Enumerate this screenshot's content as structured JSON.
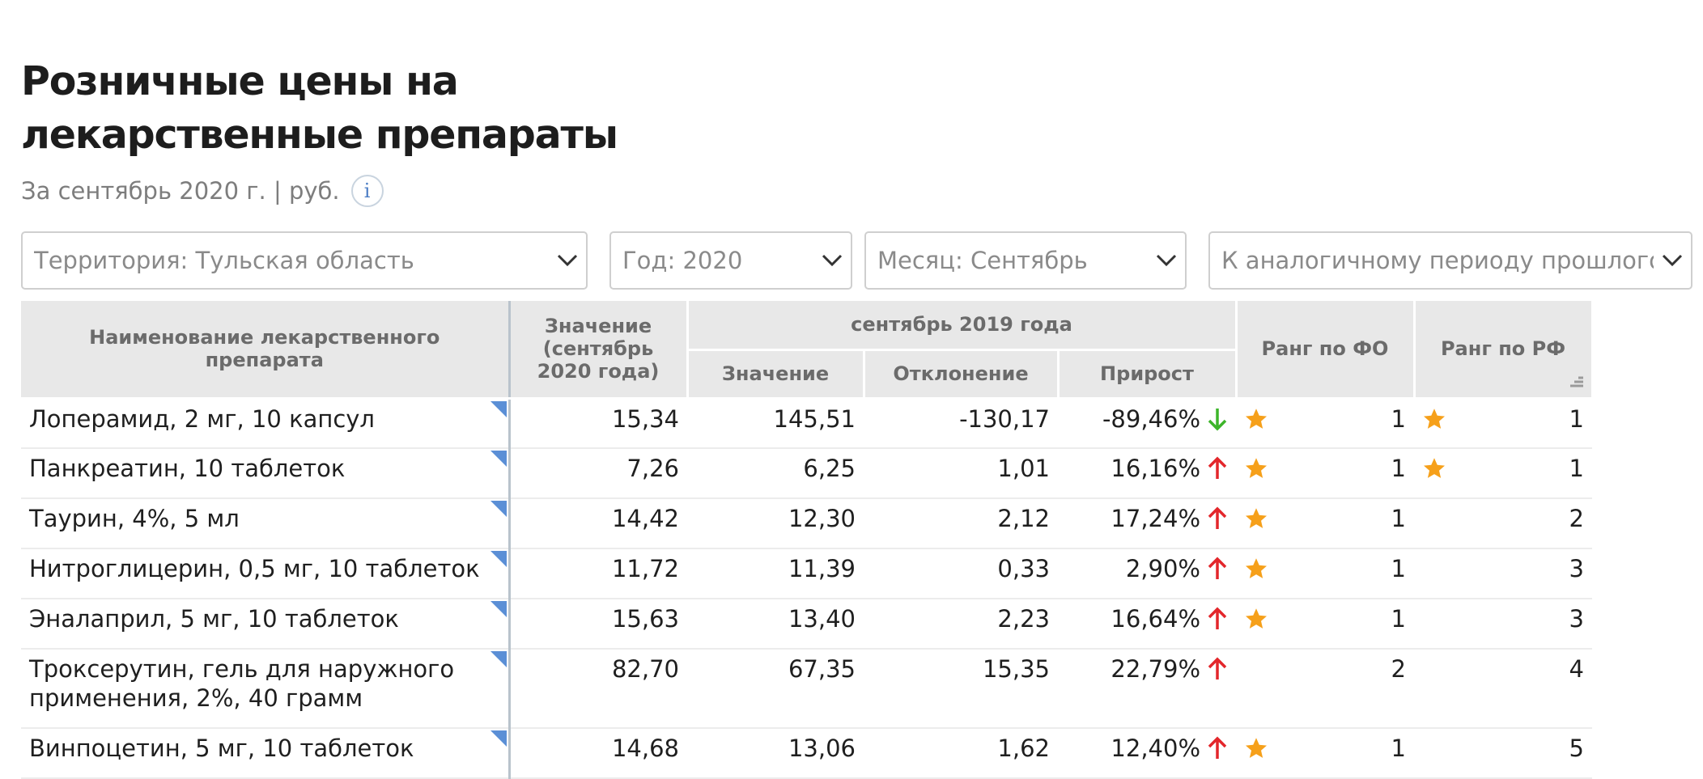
{
  "header": {
    "title": "Розничные цены на лекарственные препараты",
    "subtitle": "За сентябрь 2020 г. | руб.",
    "info_label": "i"
  },
  "filters": {
    "territory": "Территория: Тульская область",
    "year": "Год: 2020",
    "month": "Месяц: Сентябрь",
    "comparison": "К аналогичному периоду прошлого года"
  },
  "table": {
    "columns": {
      "name": "Наименование лекарственного препарата",
      "value_current": "Значение (сентябрь 2020 года)",
      "group_prev": "сентябрь 2019 года",
      "value_prev": "Значение",
      "deviation": "Отклонение",
      "growth": "Прирост",
      "rank_fo": "Ранг по ФО",
      "rank_rf": "Ранг по РФ"
    },
    "rows": [
      {
        "name": "Лоперамид, 2 мг, 10 капсул",
        "value": "15,34",
        "prev": "145,51",
        "dev": "-130,17",
        "growth": "-89,46%",
        "trend": "down",
        "rank_fo": "1",
        "star_fo": true,
        "rank_rf": "1",
        "star_rf": true
      },
      {
        "name": "Панкреатин, 10 таблеток",
        "value": "7,26",
        "prev": "6,25",
        "dev": "1,01",
        "growth": "16,16%",
        "trend": "up",
        "rank_fo": "1",
        "star_fo": true,
        "rank_rf": "1",
        "star_rf": true
      },
      {
        "name": "Таурин, 4%, 5 мл",
        "value": "14,42",
        "prev": "12,30",
        "dev": "2,12",
        "growth": "17,24%",
        "trend": "up",
        "rank_fo": "1",
        "star_fo": true,
        "rank_rf": "2",
        "star_rf": false
      },
      {
        "name": "Нитроглицерин, 0,5 мг, 10 таблеток",
        "value": "11,72",
        "prev": "11,39",
        "dev": "0,33",
        "growth": "2,90%",
        "trend": "up",
        "rank_fo": "1",
        "star_fo": true,
        "rank_rf": "3",
        "star_rf": false
      },
      {
        "name": "Эналаприл, 5 мг, 10 таблеток",
        "value": "15,63",
        "prev": "13,40",
        "dev": "2,23",
        "growth": "16,64%",
        "trend": "up",
        "rank_fo": "1",
        "star_fo": true,
        "rank_rf": "3",
        "star_rf": false
      },
      {
        "name": "Троксерутин, гель для наружного применения, 2%, 40 грамм",
        "value": "82,70",
        "prev": "67,35",
        "dev": "15,35",
        "growth": "22,79%",
        "trend": "up",
        "rank_fo": "2",
        "star_fo": false,
        "rank_rf": "4",
        "star_rf": false
      },
      {
        "name": "Винпоцетин, 5 мг, 10 таблеток",
        "value": "14,68",
        "prev": "13,06",
        "dev": "1,62",
        "growth": "12,40%",
        "trend": "up",
        "rank_fo": "1",
        "star_fo": true,
        "rank_rf": "5",
        "star_rf": false
      }
    ]
  },
  "colors": {
    "up_arrow": "#e3262b",
    "down_arrow": "#3db52a",
    "star": "#f6a01a",
    "row_flag": "#5b8fd6",
    "header_bg": "#e8e8e8"
  },
  "icons": {
    "info": "info-icon",
    "dropdown": "chevron-down-icon",
    "up": "arrow-up-icon",
    "down": "arrow-down-icon",
    "star": "star-icon",
    "sort": "sort-icon"
  }
}
